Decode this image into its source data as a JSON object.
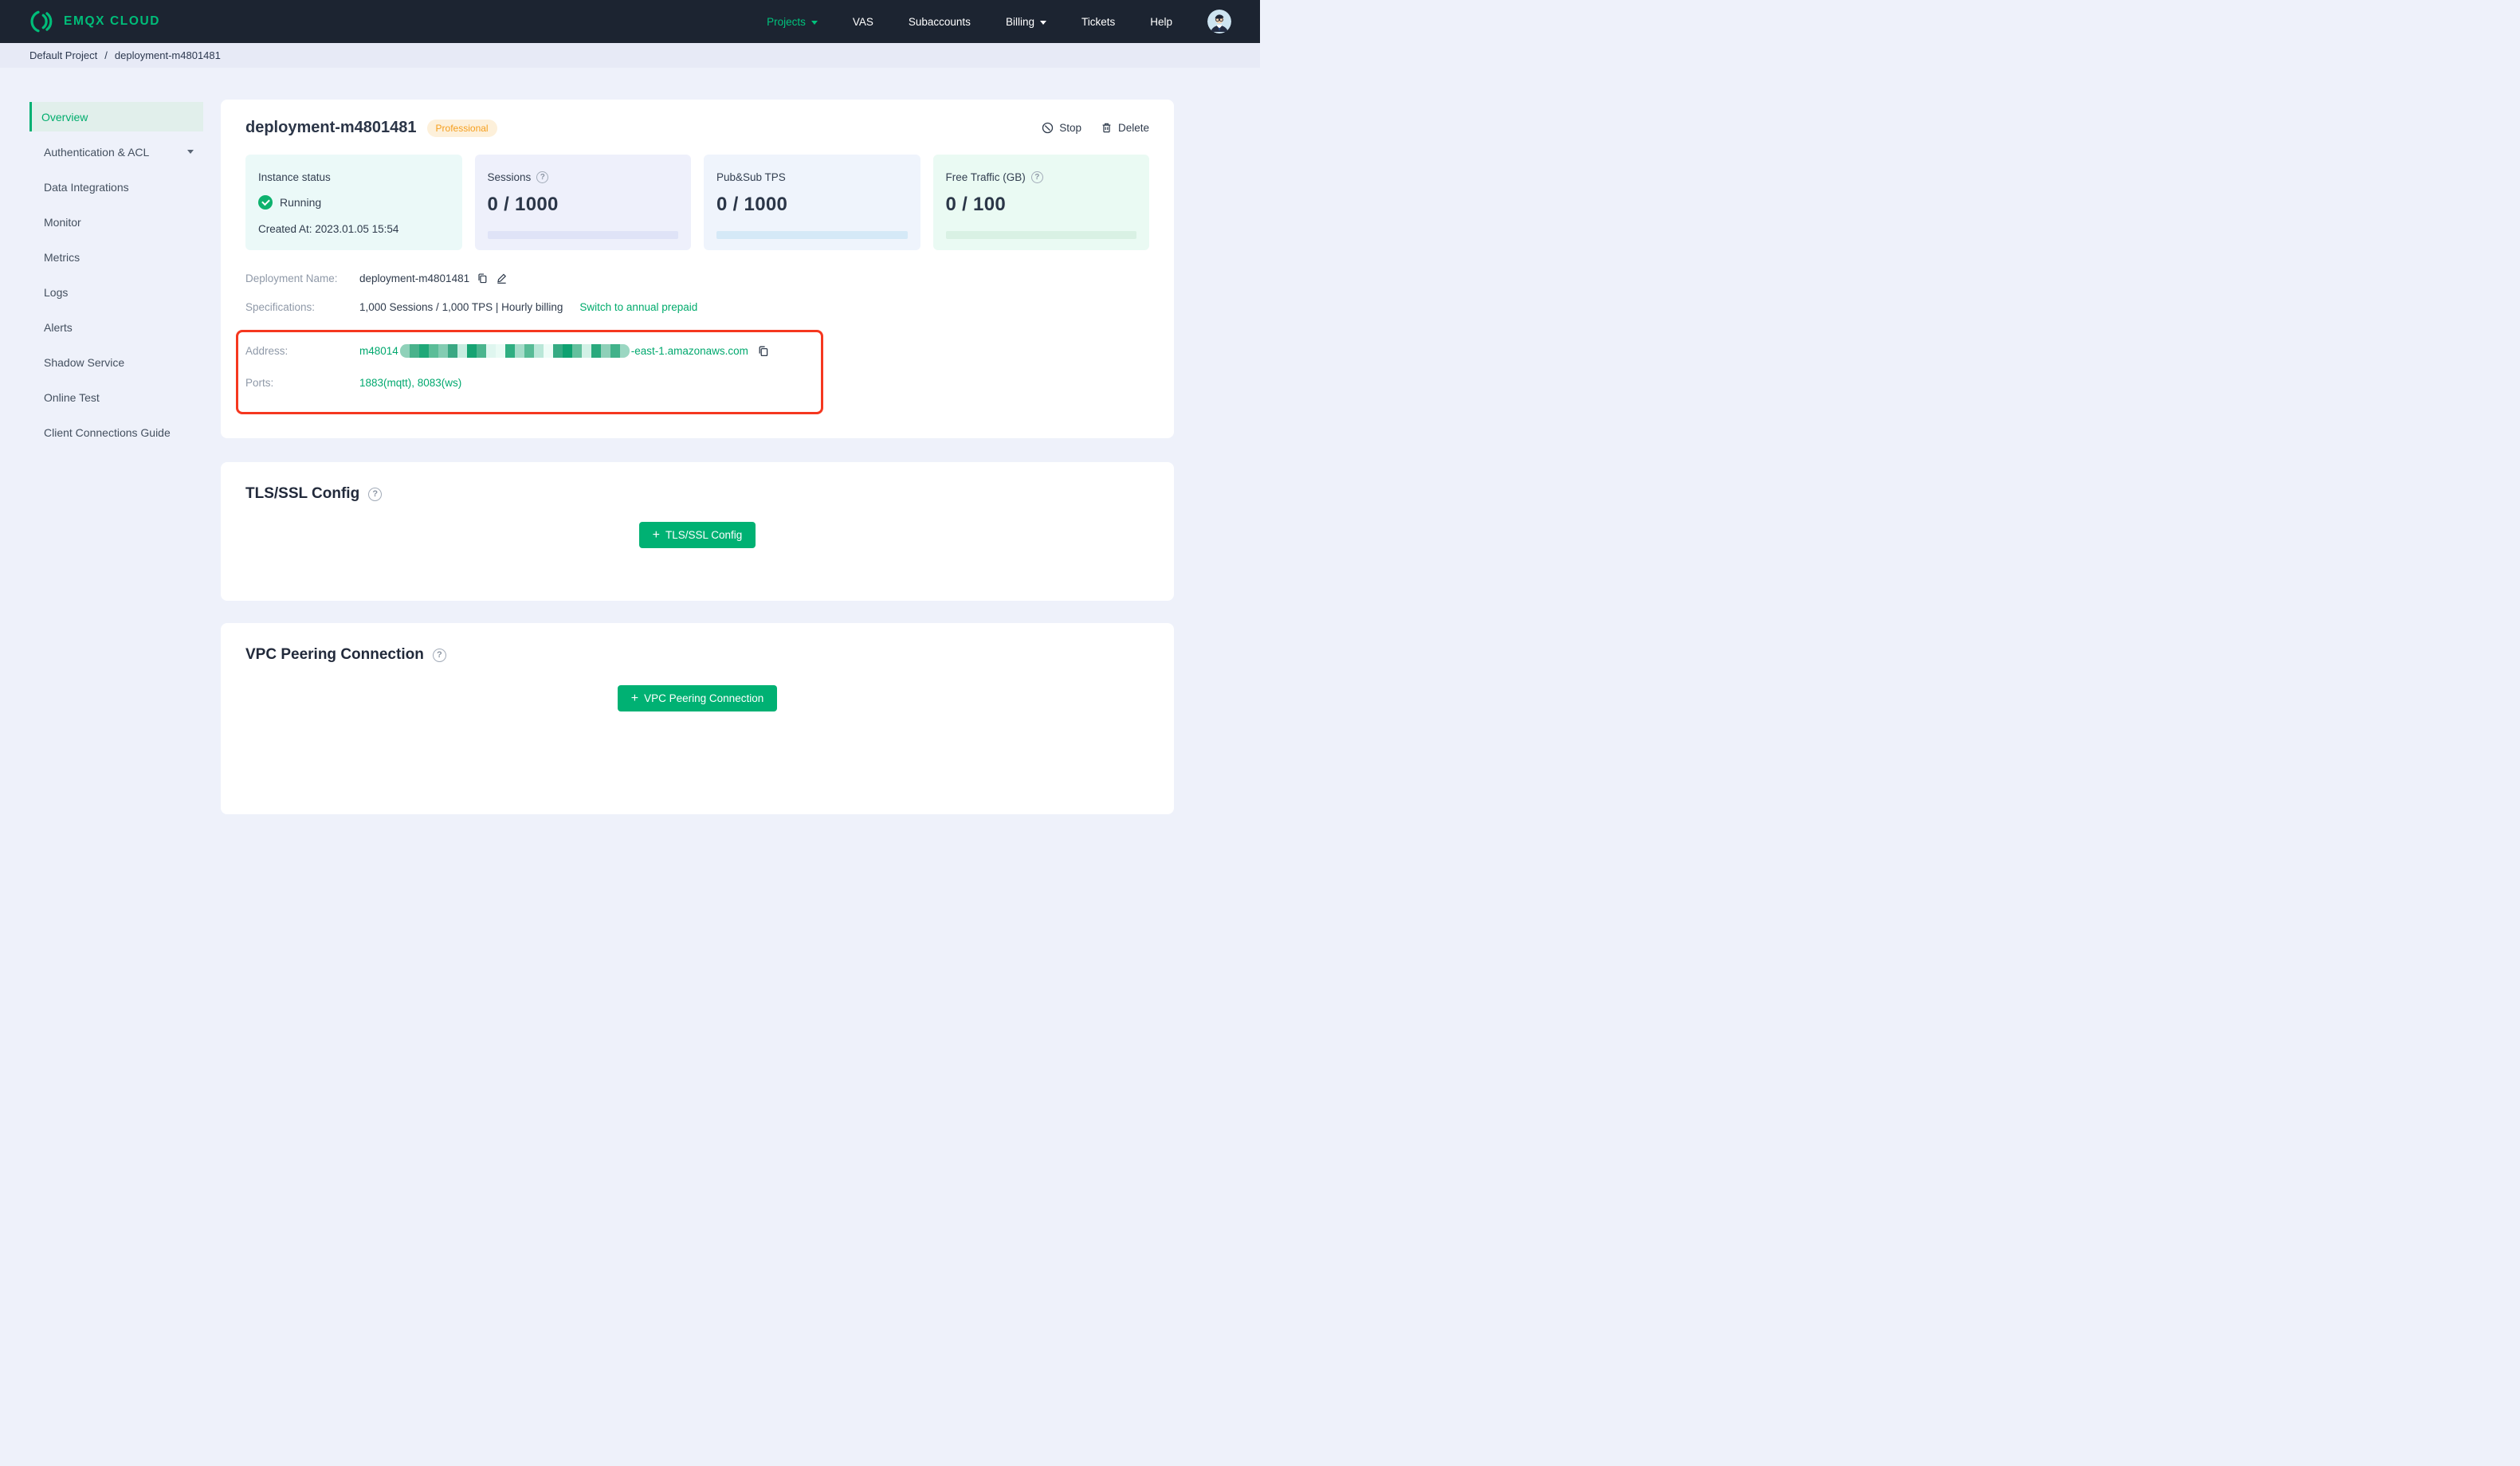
{
  "brand": {
    "name": "EMQX CLOUD",
    "accent_green": "#00b173",
    "navbar_bg": "#1c2431"
  },
  "navbar": {
    "items": [
      {
        "label": "Projects",
        "active": true,
        "caret": true
      },
      {
        "label": "VAS"
      },
      {
        "label": "Subaccounts"
      },
      {
        "label": "Billing",
        "caret": true
      },
      {
        "label": "Tickets"
      },
      {
        "label": "Help"
      }
    ]
  },
  "breadcrumb": {
    "project": "Default Project",
    "separator": "/",
    "current": "deployment-m4801481"
  },
  "sidebar": {
    "items": [
      {
        "label": "Overview",
        "active": true
      },
      {
        "label": "Authentication & ACL",
        "caret": true
      },
      {
        "label": "Data Integrations"
      },
      {
        "label": "Monitor"
      },
      {
        "label": "Metrics"
      },
      {
        "label": "Logs"
      },
      {
        "label": "Alerts"
      },
      {
        "label": "Shadow Service"
      },
      {
        "label": "Online Test"
      },
      {
        "label": "Client Connections Guide"
      }
    ]
  },
  "deployment": {
    "title": "deployment-m4801481",
    "plan_badge": "Professional",
    "actions": {
      "stop": "Stop",
      "delete": "Delete"
    },
    "stats": {
      "instance": {
        "label": "Instance status",
        "status": "Running",
        "created": "Created At: 2023.01.05 15:54",
        "bg": "#ebf9f8"
      },
      "sessions": {
        "label": "Sessions",
        "value": "0 / 1000",
        "bg": "#eef0fb",
        "bar": "#dfe3f7"
      },
      "tps": {
        "label": "Pub&Sub TPS",
        "value": "0 / 1000",
        "bg": "#eff4fc",
        "bar": "#d5e9f7"
      },
      "traffic": {
        "label": "Free Traffic (GB)",
        "value": "0 / 100",
        "bg": "#eafaf3",
        "bar": "#d9f1e4"
      }
    },
    "details": {
      "name_label": "Deployment Name:",
      "name_value": "deployment-m4801481",
      "spec_label": "Specifications:",
      "spec_value": "1,000 Sessions / 1,000 TPS | Hourly billing",
      "spec_link": "Switch to annual prepaid",
      "address_label": "Address:",
      "address_prefix": "m48014",
      "address_suffix": "-east-1.amazonaws.com",
      "address_mask_colors": [
        "#8fd1b9",
        "#49b28b",
        "#1fa878",
        "#5bbd98",
        "#83ccb2",
        "#3aa883",
        "#c7ece0",
        "#16a372",
        "#4bb58e",
        "#dff6ef",
        "#eafbf5",
        "#2fae81",
        "#a5dcc9",
        "#57bb96",
        "#bae7d8",
        "#eefcf7",
        "#35ab83",
        "#0ea170",
        "#63c09d",
        "#d2f1e6",
        "#2aa97d",
        "#8ed0b8",
        "#41b28a",
        "#9bd7c2"
      ],
      "ports_label": "Ports:",
      "ports_value": "1883(mqtt), 8083(ws)",
      "annotation_color": "#f5371f"
    }
  },
  "sections": {
    "tls": {
      "title": "TLS/SSL Config",
      "button": "TLS/SSL Config"
    },
    "vpc": {
      "title": "VPC Peering Connection",
      "button": "VPC Peering Connection"
    }
  }
}
